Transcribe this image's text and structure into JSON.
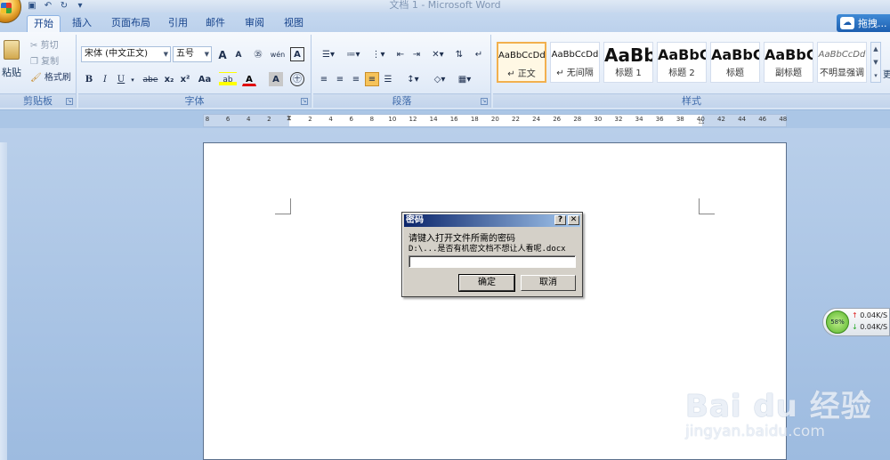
{
  "window": {
    "title": "文档 1 - Microsoft Word"
  },
  "tabs": [
    {
      "label": "开始",
      "active": true
    },
    {
      "label": "插入"
    },
    {
      "label": "页面布局"
    },
    {
      "label": "引用"
    },
    {
      "label": "邮件"
    },
    {
      "label": "审阅"
    },
    {
      "label": "视图"
    }
  ],
  "help_button": {
    "label": "拖拽..."
  },
  "clipboard": {
    "paste_label": "粘贴",
    "cut_label": "剪切",
    "copy_label": "复制",
    "format_painter_label": "格式刷",
    "group_label": "剪贴板"
  },
  "font": {
    "font_name": "宋体 (中文正文)",
    "font_size": "五号",
    "group_label": "字体",
    "grow_label": "A",
    "shrink_label": "A",
    "clear_label": "㉟",
    "phonetic_label": "wén",
    "border_label": "A",
    "bold_label": "B",
    "italic_label": "I",
    "underline_label": "U",
    "strike_label": "abe",
    "sub_label": "x₂",
    "sup_label": "x²",
    "case_label": "Aa",
    "highlight_label": "ab",
    "color_label": "A",
    "shade_label": "A",
    "enclose_label": "㊉"
  },
  "paragraph": {
    "group_label": "段落"
  },
  "styles": {
    "group_label": "样式",
    "items": [
      {
        "sample": "AaBbCcDd",
        "name": "↵ 正文"
      },
      {
        "sample": "AaBbCcDd",
        "name": "↵ 无间隔"
      },
      {
        "sample": "AaBb",
        "name": "标题 1"
      },
      {
        "sample": "AaBbC",
        "name": "标题 2"
      },
      {
        "sample": "AaBbC",
        "name": "标题"
      },
      {
        "sample": "AaBbC",
        "name": "副标题"
      },
      {
        "sample": "AaBbCcDd",
        "name": "不明显强调"
      }
    ],
    "more_label": "更"
  },
  "ruler": {
    "ticks": [
      "8",
      "6",
      "4",
      "2",
      "",
      "2",
      "4",
      "6",
      "8",
      "10",
      "12",
      "14",
      "16",
      "18",
      "20",
      "22",
      "24",
      "26",
      "28",
      "30",
      "32",
      "34",
      "36",
      "38",
      "40",
      "42",
      "44",
      "46",
      "48"
    ]
  },
  "dialog": {
    "title": "密码",
    "help_label": "?",
    "close_label": "✕",
    "prompt": "请键入打开文件所需的密码",
    "file_path": "D:\\...是否有机密文档不想让人看呢.docx",
    "password_value": "",
    "ok_label": "确定",
    "cancel_label": "取消"
  },
  "net_widget": {
    "percent": "58%",
    "upload": "0.04K/S",
    "download": "0.04K/S"
  },
  "watermark": {
    "main": "Bai du 经验",
    "sub": "jingyan.baidu.com"
  }
}
